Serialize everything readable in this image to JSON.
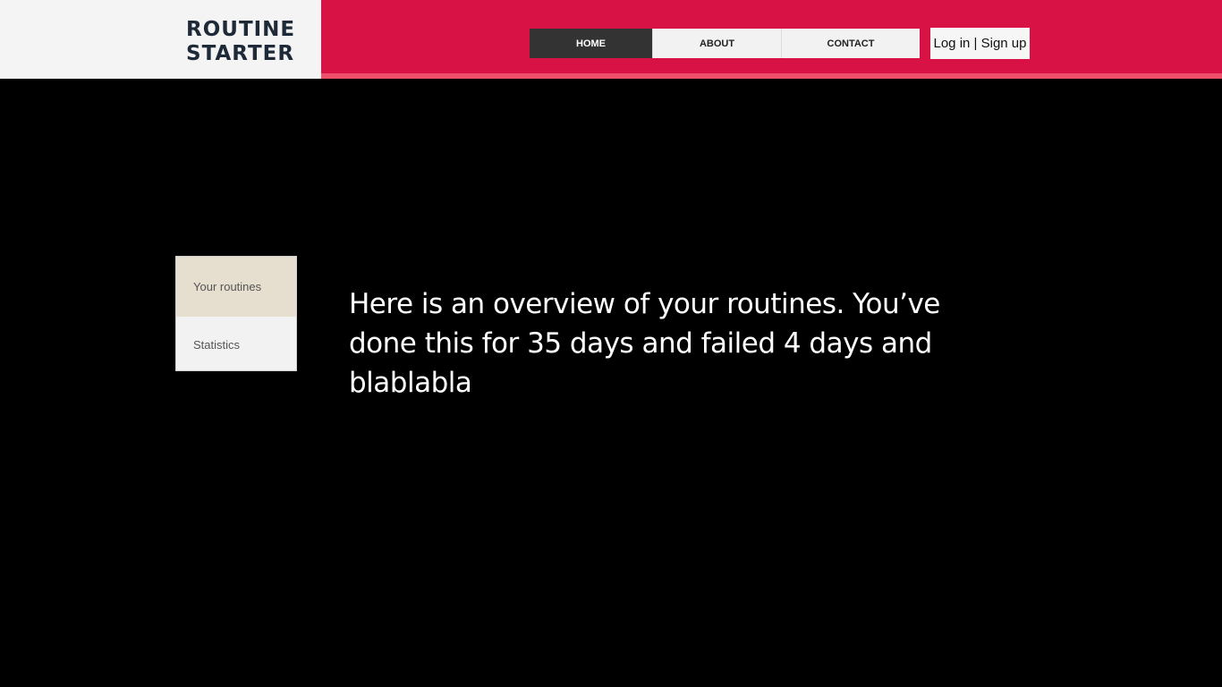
{
  "header": {
    "logo_line1": "ROUTINE",
    "logo_line2": "STARTER",
    "nav": [
      {
        "label": "HOME",
        "active": true
      },
      {
        "label": "ABOUT",
        "active": false
      },
      {
        "label": "CONTACT",
        "active": false
      }
    ],
    "login_label": "Log in | Sign up"
  },
  "sidebar": {
    "items": [
      {
        "label": "Your routines",
        "active": true
      },
      {
        "label": "Statistics",
        "active": false
      }
    ]
  },
  "main": {
    "overview_text": "Here is an overview of your routines. You’ve done this for 35 days and failed 4 days and blablabla"
  },
  "colors": {
    "brand_red": "#d81244",
    "accent_strip": "#ee4f6b",
    "nav_active": "#333333",
    "sidebar_active": "#e6dfcf",
    "background": "#000000"
  }
}
